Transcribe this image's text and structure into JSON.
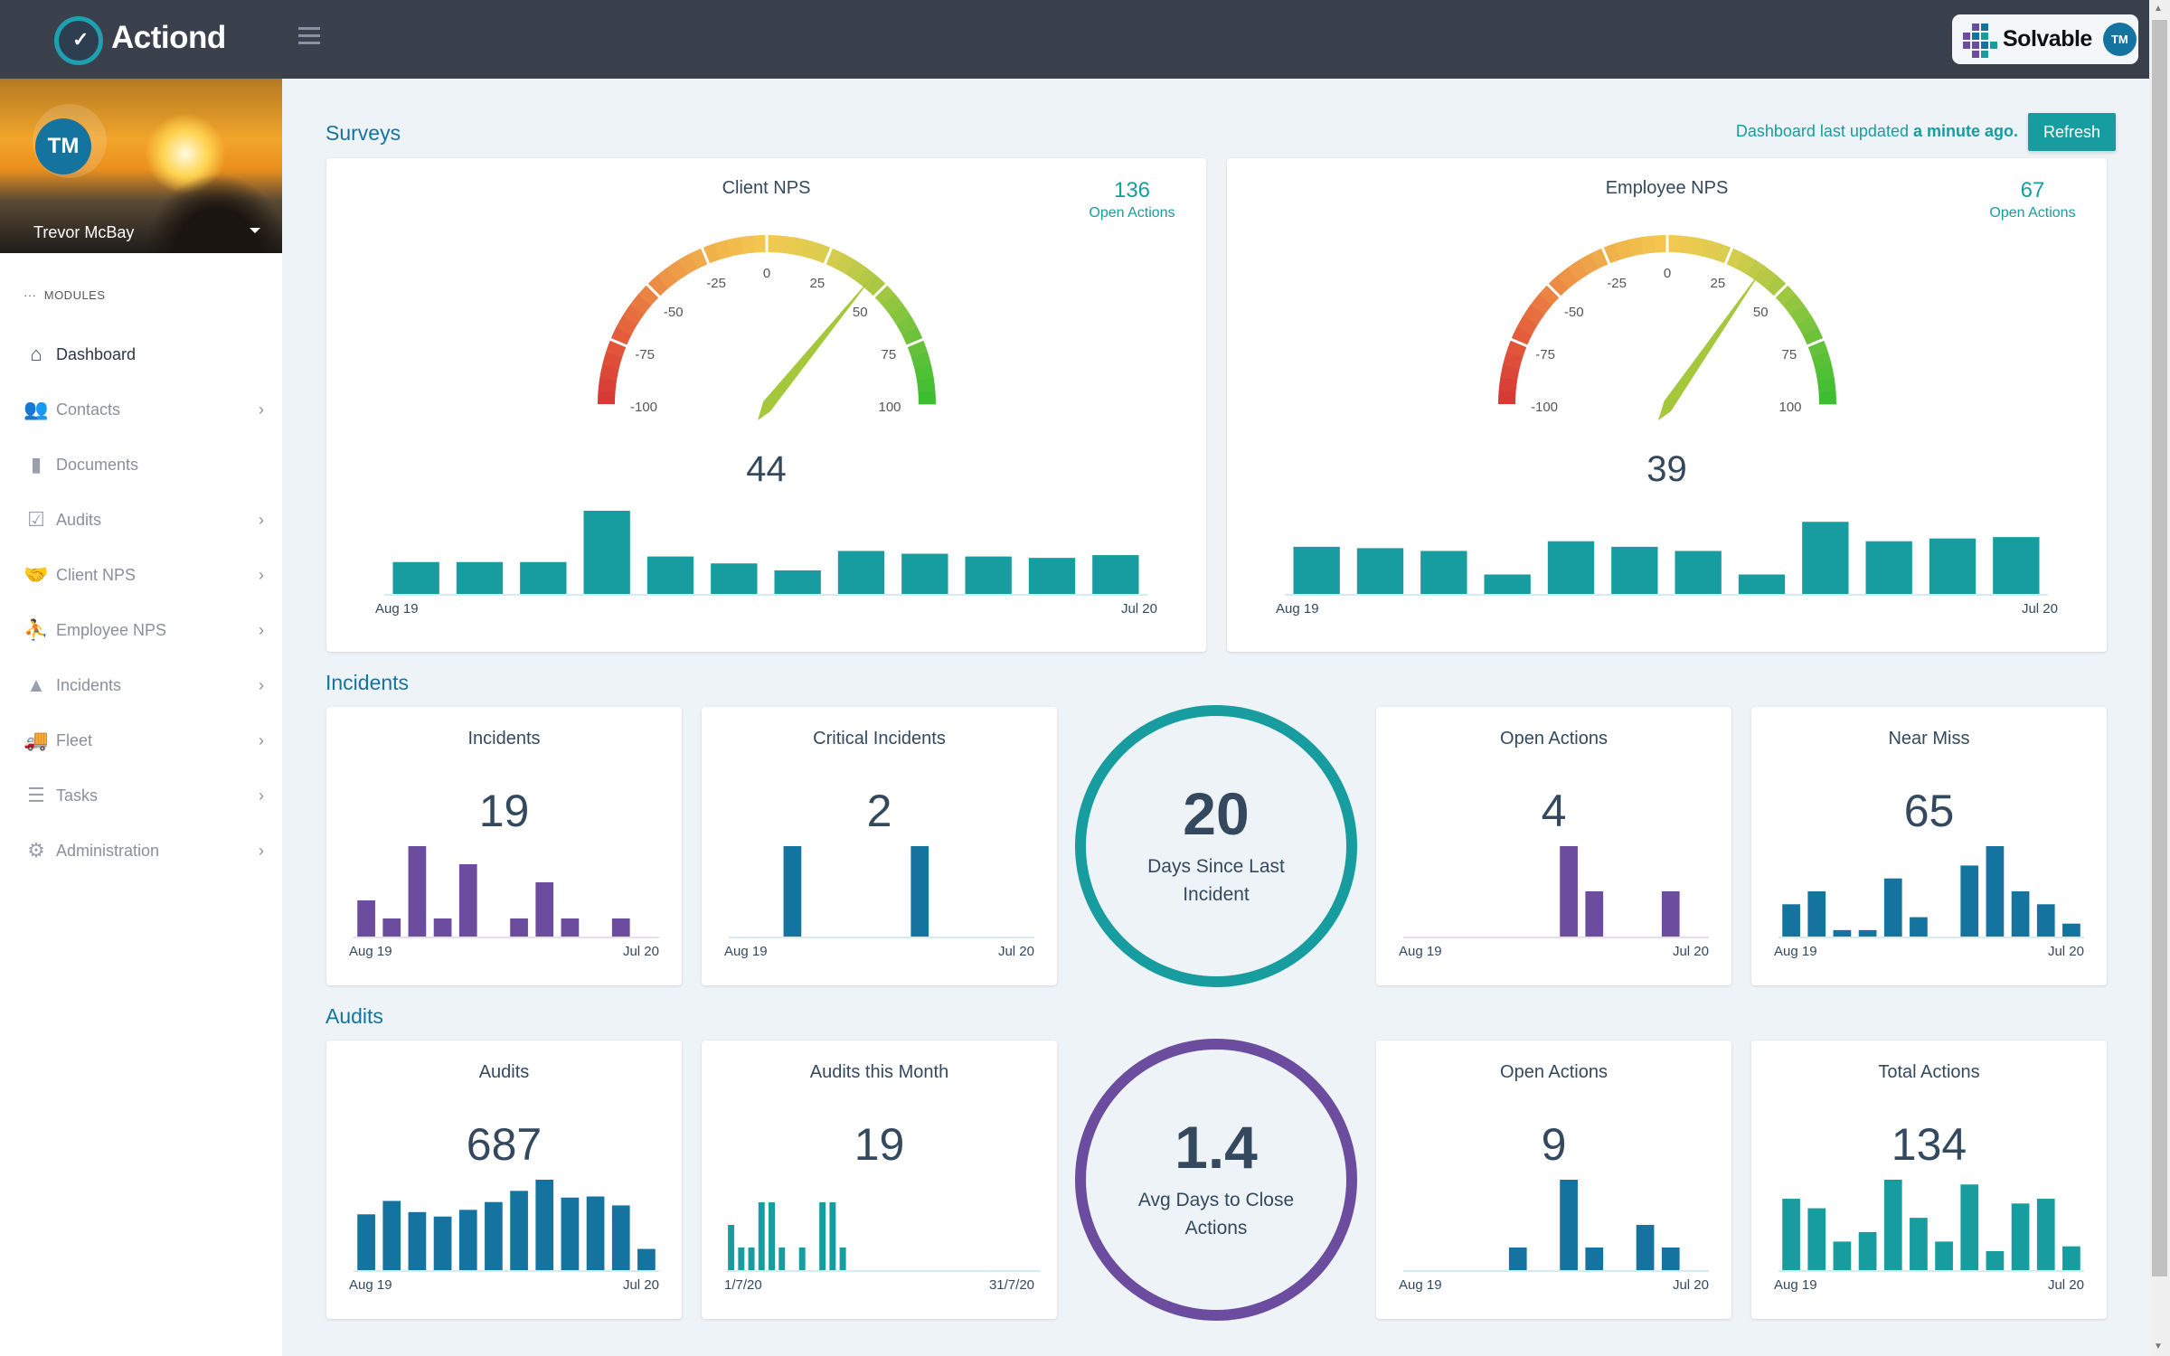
{
  "header": {
    "app_name": "Actiond",
    "brand": "Solvable",
    "user_initials": "TM",
    "colors": {
      "topbar": "#3a404c",
      "teal": "#179c9f",
      "purple": "#6b4c9e",
      "blue": "#15749f"
    }
  },
  "sidebar": {
    "profile": {
      "initials": "TM",
      "name": "Trevor McBay"
    },
    "modules_label": "MODULES",
    "items": [
      {
        "label": "Dashboard",
        "icon": "home-icon",
        "active": true,
        "has_children": false
      },
      {
        "label": "Contacts",
        "icon": "users-icon",
        "has_children": true
      },
      {
        "label": "Documents",
        "icon": "file-icon",
        "has_children": false
      },
      {
        "label": "Audits",
        "icon": "clipboard-check-icon",
        "has_children": true
      },
      {
        "label": "Client NPS",
        "icon": "handshake-icon",
        "has_children": true
      },
      {
        "label": "Employee NPS",
        "icon": "people-carry-icon",
        "has_children": true
      },
      {
        "label": "Incidents",
        "icon": "warning-icon",
        "has_children": true
      },
      {
        "label": "Fleet",
        "icon": "truck-icon",
        "has_children": true
      },
      {
        "label": "Tasks",
        "icon": "tasks-icon",
        "has_children": true
      },
      {
        "label": "Administration",
        "icon": "gears-icon",
        "has_children": true
      }
    ]
  },
  "toolbar": {
    "updated_prefix": "Dashboard last updated",
    "updated_when": "a minute ago.",
    "refresh_label": "Refresh"
  },
  "sections": {
    "surveys": "Surveys",
    "incidents": "Incidents",
    "audits": "Audits"
  },
  "chart_data": [
    {
      "type": "gauge+bar",
      "title": "Client NPS",
      "value": 44,
      "open_actions_count": "136",
      "open_actions_label": "Open Actions",
      "gauge_range": [
        -100,
        100
      ],
      "gauge_ticks": [
        -100,
        -75,
        -50,
        -25,
        0,
        25,
        50,
        75,
        100
      ],
      "x_start": "Aug 19",
      "x_end": "Jul 20",
      "color": "#179c9f",
      "values": [
        23,
        23,
        23,
        60,
        27,
        22,
        17,
        31,
        29,
        27,
        26,
        28
      ]
    },
    {
      "type": "gauge+bar",
      "title": "Employee NPS",
      "value": 39,
      "open_actions_count": "67",
      "open_actions_label": "Open Actions",
      "gauge_range": [
        -100,
        100
      ],
      "gauge_ticks": [
        -100,
        -75,
        -50,
        -25,
        0,
        25,
        50,
        75,
        100
      ],
      "x_start": "Aug 19",
      "x_end": "Jul 20",
      "color": "#179c9f",
      "values": [
        34,
        33,
        31,
        14,
        38,
        34,
        31,
        14,
        52,
        38,
        40,
        41
      ]
    },
    {
      "type": "bar",
      "title": "Incidents",
      "total": "19",
      "x_start": "Aug 19",
      "x_end": "Jul 20",
      "color": "#6b4c9e",
      "values": [
        2,
        1,
        5,
        1,
        4,
        0,
        1,
        3,
        1,
        0,
        1,
        0
      ]
    },
    {
      "type": "bar",
      "title": "Critical Incidents",
      "total": "2",
      "x_start": "Aug 19",
      "x_end": "Jul 20",
      "color": "#15749f",
      "values": [
        0,
        0,
        1,
        0,
        0,
        0,
        0,
        1,
        0,
        0,
        0,
        0
      ]
    },
    {
      "type": "bar",
      "title": "Open Actions",
      "total": "4",
      "x_start": "Aug 19",
      "x_end": "Jul 20",
      "color": "#6b4c9e",
      "values": [
        0,
        0,
        0,
        0,
        0,
        0,
        2,
        1,
        0,
        0,
        1,
        0
      ]
    },
    {
      "type": "bar",
      "title": "Near Miss",
      "total": "65",
      "x_start": "Aug 19",
      "x_end": "Jul 20",
      "color": "#15749f",
      "values": [
        5,
        7,
        1,
        1,
        9,
        3,
        0,
        11,
        14,
        7,
        5,
        2
      ]
    },
    {
      "type": "bar",
      "title": "Audits",
      "total": "687",
      "x_start": "Aug 19",
      "x_end": "Jul 20",
      "color": "#15749f",
      "values": [
        50,
        62,
        52,
        48,
        54,
        61,
        71,
        81,
        65,
        66,
        58,
        19
      ]
    },
    {
      "type": "bar",
      "title": "Audits this Month",
      "total": "19",
      "x_start": "1/7/20",
      "x_end": "31/7/20",
      "color": "#179c9f",
      "values": [
        2,
        1,
        1,
        3,
        3,
        1,
        0,
        1,
        0,
        3,
        3,
        1,
        0,
        0,
        0,
        0,
        0,
        0,
        0,
        0,
        0,
        0,
        0,
        0,
        0,
        0,
        0,
        0,
        0,
        0,
        0
      ]
    },
    {
      "type": "bar",
      "title": "Open Actions",
      "total": "9",
      "x_start": "Aug 19",
      "x_end": "Jul 20",
      "color": "#15749f",
      "values": [
        0,
        0,
        0,
        0,
        1,
        0,
        4,
        1,
        0,
        2,
        1,
        0
      ]
    },
    {
      "type": "bar",
      "title": "Total Actions",
      "total": "134",
      "x_start": "Aug 19",
      "x_end": "Jul 20",
      "color": "#179c9f",
      "values": [
        15,
        13,
        6,
        8,
        19,
        11,
        6,
        18,
        4,
        14,
        15,
        5
      ]
    }
  ],
  "rings": [
    {
      "value": "20",
      "label": "Days Since Last Incident",
      "color": "#179c9f"
    },
    {
      "value": "1.4",
      "label": "Avg Days to Close Actions",
      "color": "#6b4c9e"
    }
  ]
}
